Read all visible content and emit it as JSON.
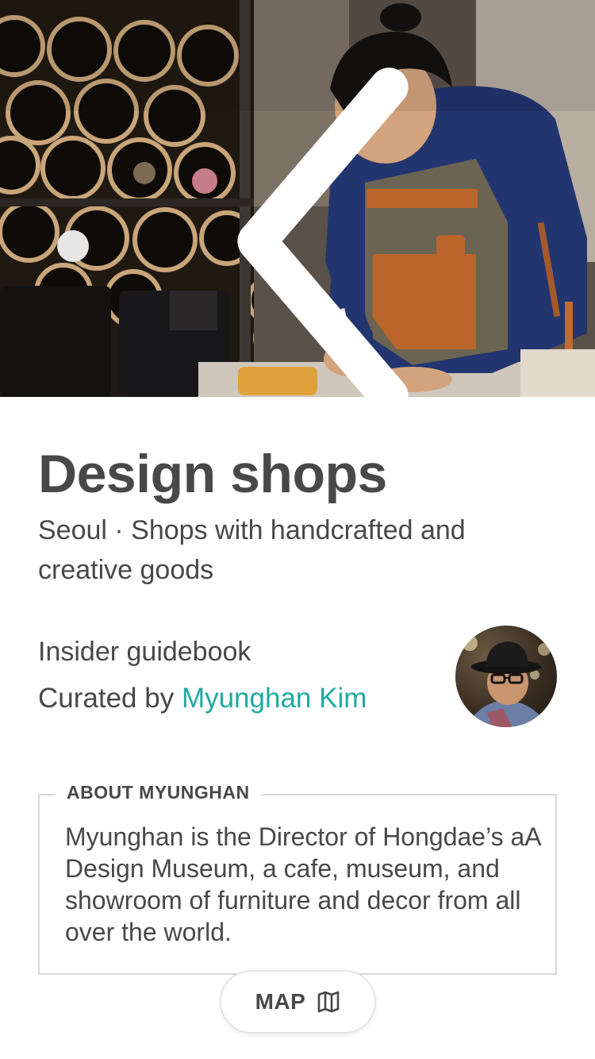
{
  "header": {
    "back_icon": "chevron-left-icon",
    "share_icon": "share-icon"
  },
  "guide": {
    "title": "Design shops",
    "subtitle": "Seoul · Shops with handcrafted and creative goods",
    "type_label": "Insider guidebook",
    "curated_prefix": "Curated by ",
    "curator_name": "Myunghan Kim"
  },
  "about": {
    "heading": "ABOUT MYUNGHAN",
    "text": "Myunghan is the Director of Hongdae’s aA Design Museum, a cafe, museum, and showroom of furniture and decor from all over the world."
  },
  "map_button": {
    "label": "MAP",
    "icon": "map-icon"
  },
  "colors": {
    "text": "#484848",
    "link_accent": "#1faaa2",
    "border": "#d8d8d8"
  }
}
